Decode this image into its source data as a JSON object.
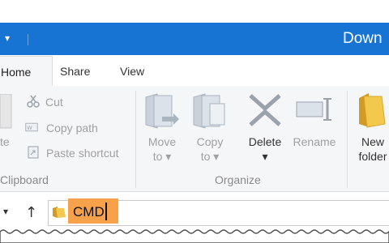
{
  "window": {
    "title": "Down"
  },
  "quick_access": {
    "arrow": "▾"
  },
  "tabs": [
    {
      "label": "Home",
      "active": true
    },
    {
      "label": "Share"
    },
    {
      "label": "View"
    }
  ],
  "clipboard": {
    "label": "Clipboard",
    "paste_fragment": "te",
    "cut": "Cut",
    "copy_path": "Copy path",
    "paste_shortcut": "Paste shortcut"
  },
  "organize": {
    "label": "Organize",
    "move_to": [
      "Move",
      "to ▾"
    ],
    "copy_to": [
      "Copy",
      "to ▾"
    ],
    "delete": "Delete",
    "delete_arrow": "▾",
    "rename": "Rename"
  },
  "new_group": {
    "new_folder": [
      "New",
      "folder"
    ]
  },
  "address": {
    "back": "▾",
    "up": "↑",
    "value": "CMD"
  },
  "colors": {
    "title_bar": "#1874d3",
    "highlight": "#f7a24a",
    "folder": "#e8b53b"
  }
}
